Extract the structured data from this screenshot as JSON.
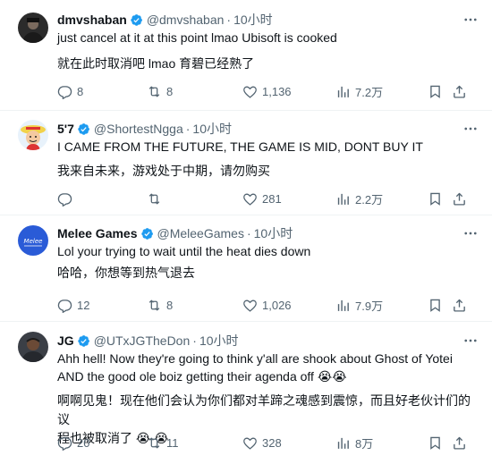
{
  "tweets": [
    {
      "name": "dmvshaban",
      "handle": "@dmvshaban",
      "dot": "·",
      "time": "10小时",
      "text": "just cancel at it at this point lmao Ubisoft is cooked",
      "translation": "就在此时取消吧 lmao 育碧已经熟了",
      "replies": "8",
      "reposts": "8",
      "likes": "1,136",
      "views": "7.2万"
    },
    {
      "name": "5'7",
      "handle": "@ShortestNgga",
      "dot": "·",
      "time": "10小时",
      "text": "I CAME FROM THE FUTURE, THE GAME IS MID, DONT BUY IT",
      "translation": "我来自未来，游戏处于中期，请勿购买",
      "replies": "",
      "reposts": "",
      "likes": "281",
      "views": "2.2万"
    },
    {
      "name": "Melee Games",
      "handle": "@MeleeGames",
      "dot": "·",
      "time": "10小时",
      "text": "Lol your trying to wait until the heat dies down",
      "translation": "哈哈，你想等到热气退去",
      "replies": "12",
      "reposts": "8",
      "likes": "1,026",
      "views": "7.9万"
    },
    {
      "name": "JG",
      "handle": "@UTxJGTheDon",
      "dot": "·",
      "time": "10小时",
      "text_line1": "Ahh hell! Now they're going to think y'all are shook about Ghost of Yotei",
      "text_line2": "AND the good ole boiz getting their agenda off",
      "emoji": "😭",
      "translation_line1": "啊啊见鬼！现在他们会认为你们都对羊蹄之魂感到震惊，而且好老伙计们的议",
      "translation_line2": "程也被取消了",
      "replies": "20",
      "reposts": "11",
      "likes": "328",
      "views": "8万"
    }
  ],
  "colors": {
    "text": "#0f1419",
    "muted": "#536471",
    "verified": "#1d9bf0",
    "divider": "#eff3f4"
  }
}
